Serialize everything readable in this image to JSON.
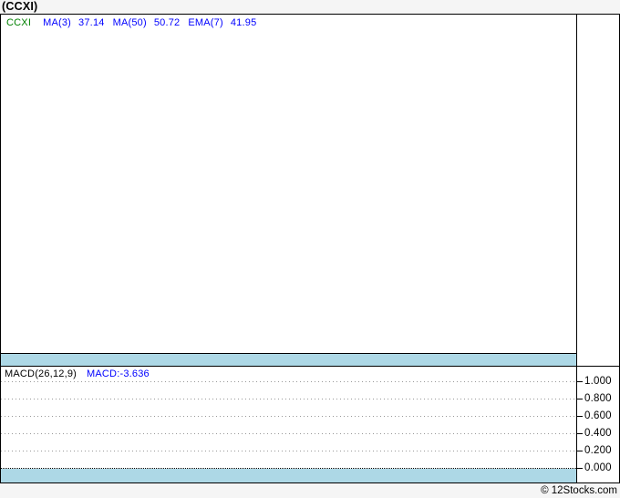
{
  "header": {
    "title": "(CCXI)"
  },
  "footer": {
    "credit": "© 12Stocks.com"
  },
  "colors": {
    "page_bg": "#F5F5F5",
    "panel_bg": "#FFFFFF",
    "frame": "#000000",
    "separator_band": "#ADD8E6",
    "ticker_text": "#008000",
    "indicator_text": "#0000FF",
    "grid_dots": "#999999",
    "zero_line_dots": "#000000"
  },
  "chart_data": {
    "type": "line",
    "title": "(CCXI)",
    "panels": [
      {
        "id": "price",
        "legend": {
          "ticker": "CCXI",
          "indicators": [
            {
              "label": "MA(3)",
              "value": "37.14"
            },
            {
              "label": "MA(50)",
              "value": "50.72"
            },
            {
              "label": "EMA(7)",
              "value": "41.95"
            }
          ]
        },
        "series": []
      },
      {
        "id": "macd",
        "indicator_label": "MACD(26,12,9)",
        "value_label": "MACD:-3.636",
        "macd_value": -3.636,
        "y_axis": {
          "side": "right",
          "ticks": [
            1.0,
            0.8,
            0.6,
            0.4,
            0.2,
            0.0
          ],
          "tick_labels": [
            "1.000",
            "0.800",
            "0.600",
            "0.400",
            "0.200",
            "0.000"
          ],
          "range_visible": [
            -0.17,
            1.17
          ]
        },
        "grid": "dotted-horizontal",
        "series": []
      }
    ]
  }
}
